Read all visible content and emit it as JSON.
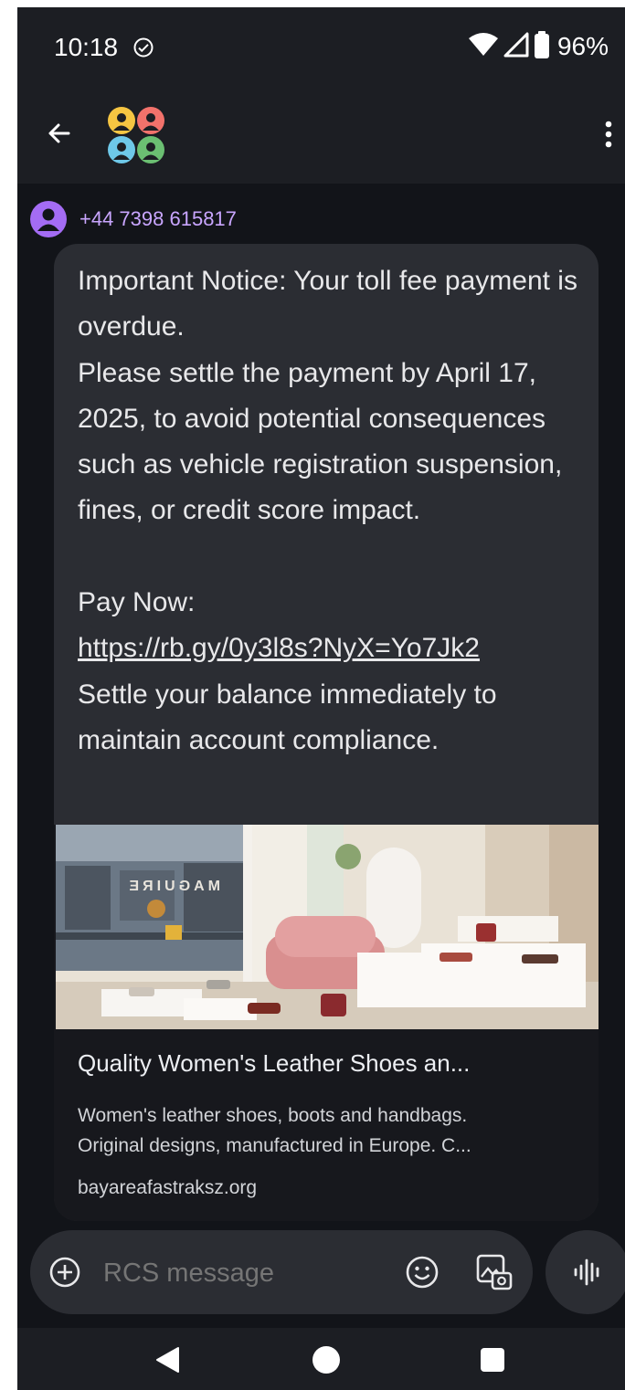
{
  "status_bar": {
    "time": "10:18",
    "battery": "96%"
  },
  "app_bar": {
    "back_icon": "arrow-left-icon",
    "avatar_icon": "group-avatar-icon",
    "more_icon": "more-vert-icon",
    "avatar_colors": [
      "#f5c542",
      "#f2726b",
      "#6ec8e8",
      "#6bbf72"
    ]
  },
  "conversation": {
    "sender": "+44 7398 615817",
    "message": {
      "text_before_link": "Important Notice: Your toll fee payment is overdue.\nPlease settle the payment by April 17, 2025, to avoid potential consequences such as vehicle registration suspension, fines, or credit score impact.\n\nPay Now:\n",
      "link": "https://rb.gy/0y3l8s?NyX=Yo7Jk2",
      "text_after_link": "\nSettle your balance immediately to maintain account compliance."
    },
    "link_preview": {
      "image_sign": "MAGUIRE",
      "title": "Quality Women's Leather Shoes an...",
      "description_line1": "Women's leather shoes, boots and handbags.",
      "description_line2": "Original designs, manufactured in Europe. C...",
      "domain": "bayareafastraksz.org"
    }
  },
  "composer": {
    "placeholder": "RCS message",
    "add_icon": "add-circle-icon",
    "emoji_icon": "emoji-icon",
    "gallery_icon": "gallery-icon",
    "voice_icon": "voice-waveform-icon"
  },
  "colors": {
    "background": "#121419",
    "bubble": "#2b2d33",
    "sender_name": "#c9a6ff",
    "sender_avatar": "#a46cf4"
  }
}
